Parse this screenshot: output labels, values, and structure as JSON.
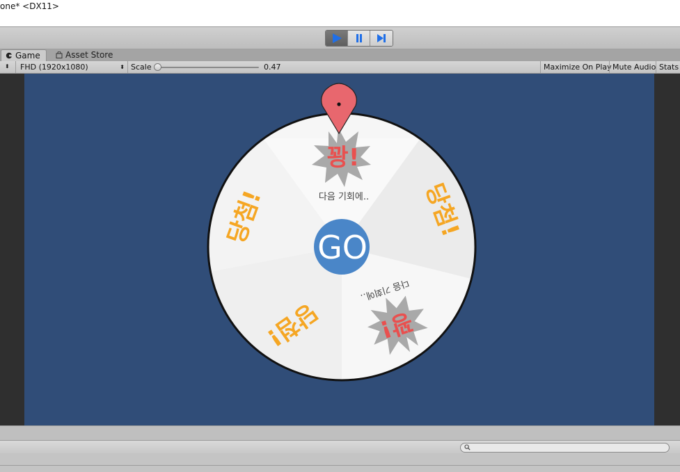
{
  "window": {
    "title": "one* <DX11>"
  },
  "toolbar": {
    "play_icon": "play-icon",
    "pause_icon": "pause-icon",
    "step_icon": "step-icon",
    "accent": "#1f6fe8"
  },
  "tabs": [
    {
      "label": "Game",
      "icon": "game-controller-icon",
      "active": true
    },
    {
      "label": "Asset Store",
      "icon": "store-bag-icon",
      "active": false
    }
  ],
  "gamebar": {
    "resolution": "FHD (1920x1080)",
    "scale_label": "Scale",
    "scale_value": "0.47",
    "scale_fraction": 0.0,
    "maximize_on_play": "Maximize On Play",
    "mute_audio": "Mute Audio",
    "stats": "Stats"
  },
  "wheel": {
    "colors": {
      "background": "#304d78",
      "segment_light": "#f6f6f6",
      "segment_dark": "#eaeaea",
      "rim": "#111111",
      "win_text": "#f5a623",
      "lose_text": "#e9504f",
      "burst": "#a9a9a9",
      "go_button": "#4a86c8",
      "pointer": "#e8676e"
    },
    "go_label": "GO",
    "segments": [
      {
        "label": "꽝!",
        "sublabel": "다음 기회에..",
        "type": "lose"
      },
      {
        "label": "당첨!",
        "type": "win"
      },
      {
        "label": "꽝!",
        "sublabel": "다음 기회에..",
        "type": "lose"
      },
      {
        "label": "당첨!",
        "type": "win"
      },
      {
        "label": "당첨!",
        "type": "win"
      }
    ]
  },
  "console": {
    "search_icon": "search-icon"
  }
}
